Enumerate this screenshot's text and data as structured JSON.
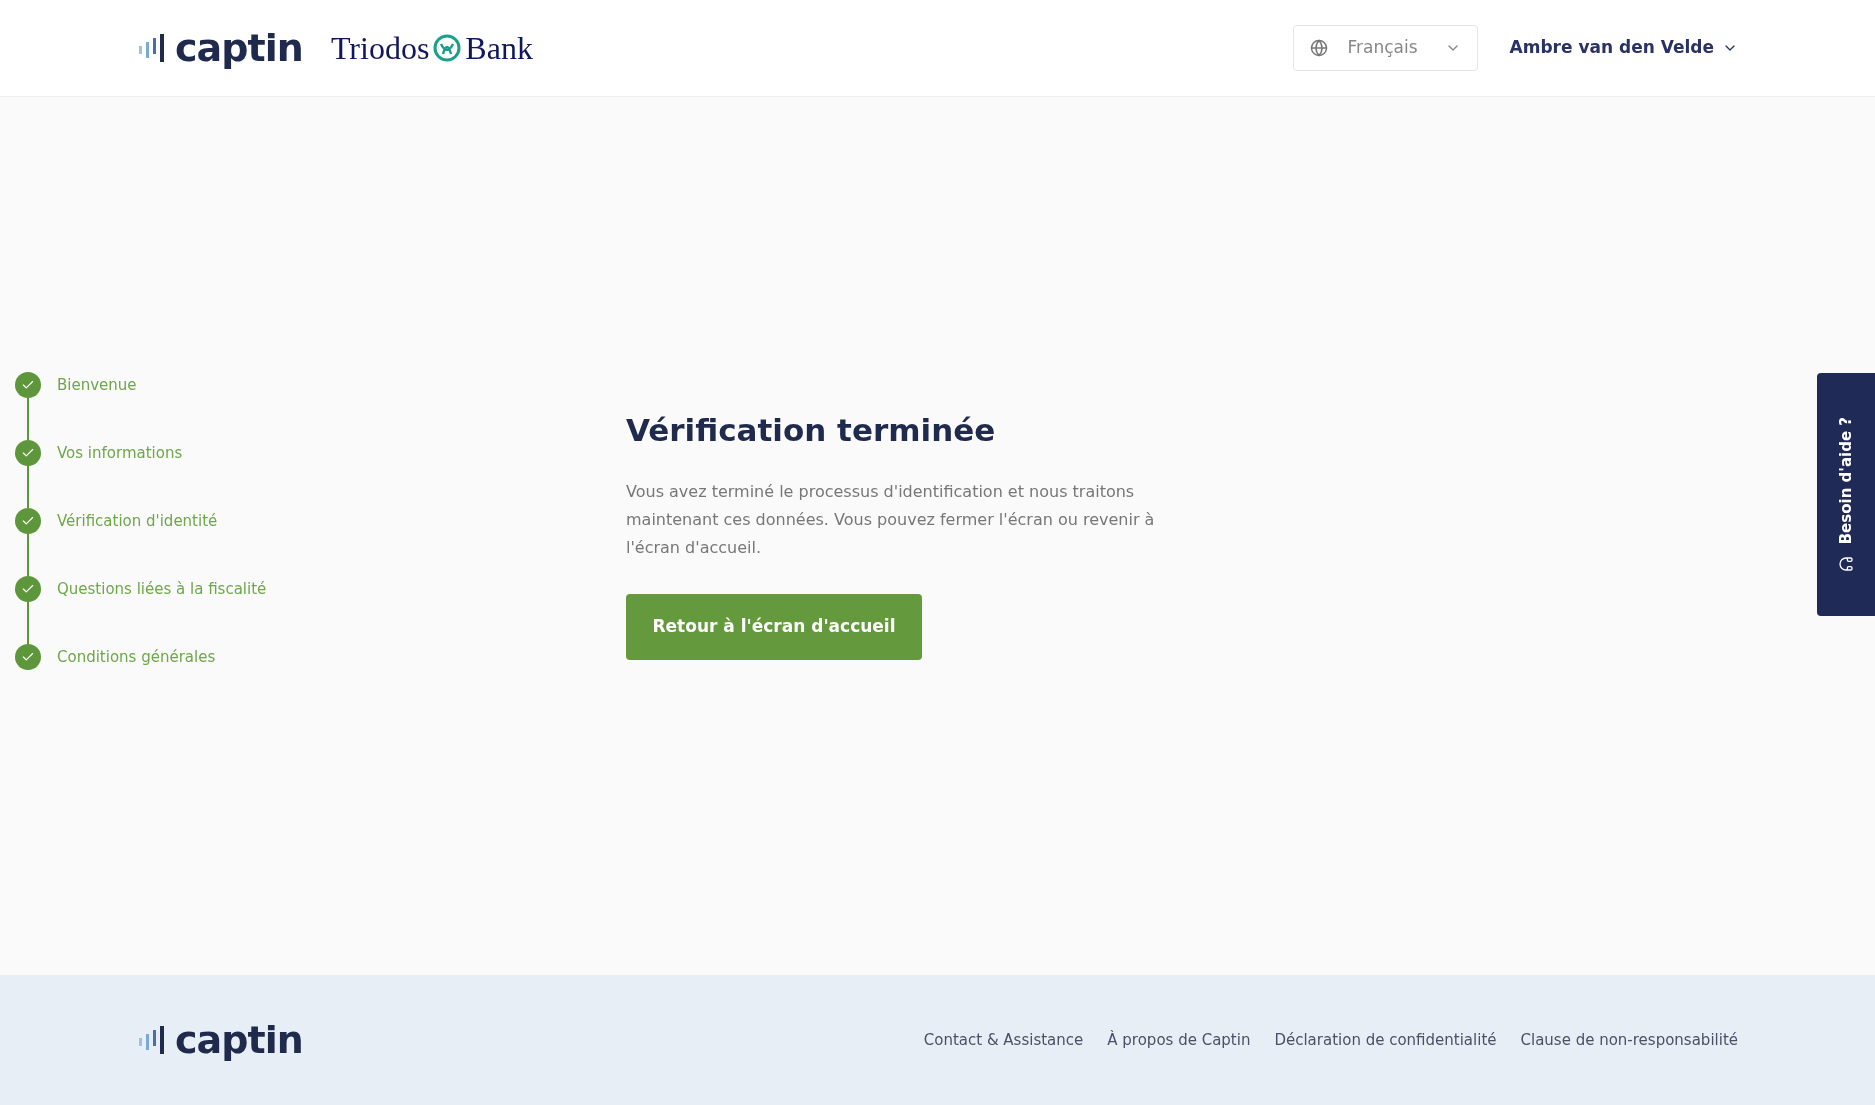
{
  "header": {
    "brand": "captin",
    "partner": {
      "first_word": "Triodos",
      "second_word": "Bank"
    },
    "language": {
      "value": "Français"
    },
    "user": {
      "name": "Ambre van den Velde"
    }
  },
  "steps": [
    {
      "label": "Bienvenue",
      "done": true
    },
    {
      "label": "Vos informations",
      "done": true
    },
    {
      "label": "Vérification d'identité",
      "done": true
    },
    {
      "label": "Questions liées à la fiscalité",
      "done": true
    },
    {
      "label": "Conditions générales",
      "done": true
    }
  ],
  "main": {
    "title": "Vérification terminée",
    "text": "Vous avez terminé le processus d'identification et nous traitons maintenant ces données. Vous pouvez fermer l'écran ou revenir à l'écran d'accueil.",
    "button": "Retour à l'écran d'accueil"
  },
  "help_tab": {
    "label": "Besoin d'aide ?"
  },
  "footer": {
    "brand": "captin",
    "links": [
      "Contact & Assistance",
      "À propos de Captin",
      "Déclaration de confidentialité",
      "Clause de non-responsabilité"
    ]
  }
}
